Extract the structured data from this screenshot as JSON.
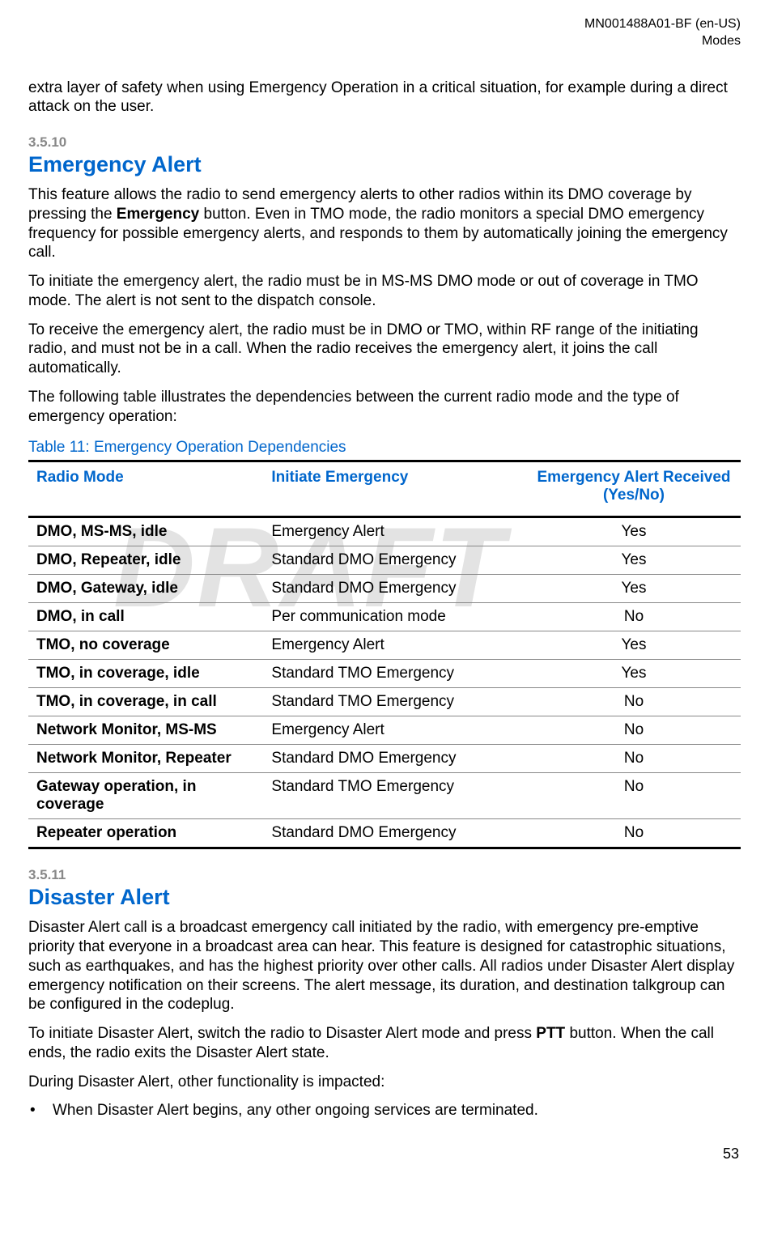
{
  "header": {
    "doc_id": "MN001488A01-BF (en-US)",
    "chapter": "Modes"
  },
  "watermark": "DRAFT",
  "intro": "extra layer of safety when using Emergency Operation in a critical situation, for example during a direct attack on the user.",
  "s1": {
    "num": "3.5.10",
    "title": "Emergency Alert",
    "p1a": "This feature allows the radio to send emergency alerts to other radios within its DMO coverage by pressing the ",
    "p1_bold": "Emergency",
    "p1b": " button. Even in TMO mode, the radio monitors a special DMO emergency frequency for possible emergency alerts, and responds to them by automatically joining the emergency call.",
    "p2": "To initiate the emergency alert, the radio must be in MS-MS DMO mode or out of coverage in TMO mode. The alert is not sent to the dispatch console.",
    "p3": "To receive the emergency alert, the radio must be in DMO or TMO, within RF range of the initiating radio, and must not be in a call. When the radio receives the emergency alert, it joins the call automatically.",
    "p4": "The following table illustrates the dependencies between the current radio mode and the type of emergency operation:"
  },
  "table": {
    "caption": "Table 11: Emergency Operation Dependencies",
    "h1": "Radio Mode",
    "h2": "Initiate Emergency",
    "h3": "Emergency Alert Received (Yes/No)",
    "rows": [
      {
        "c1": "DMO, MS-MS, idle",
        "c2": "Emergency Alert",
        "c3": "Yes"
      },
      {
        "c1": "DMO, Repeater, idle",
        "c2": "Standard DMO Emergency",
        "c3": "Yes"
      },
      {
        "c1": "DMO, Gateway, idle",
        "c2": "Standard DMO Emergency",
        "c3": "Yes"
      },
      {
        "c1": "DMO, in call",
        "c2": "Per communication mode",
        "c3": "No"
      },
      {
        "c1": "TMO, no coverage",
        "c2": "Emergency Alert",
        "c3": "Yes"
      },
      {
        "c1": "TMO, in coverage, idle",
        "c2": "Standard TMO Emergency",
        "c3": "Yes"
      },
      {
        "c1": "TMO, in coverage, in call",
        "c2": "Standard TMO Emergency",
        "c3": "No"
      },
      {
        "c1": "Network Monitor, MS-MS",
        "c2": "Emergency Alert",
        "c3": "No"
      },
      {
        "c1": "Network Monitor, Repeater",
        "c2": "Standard DMO Emergency",
        "c3": "No"
      },
      {
        "c1": "Gateway operation, in coverage",
        "c2": "Standard TMO Emergency",
        "c3": "No"
      },
      {
        "c1": "Repeater operation",
        "c2": "Standard DMO Emergency",
        "c3": "No"
      }
    ]
  },
  "s2": {
    "num": "3.5.11",
    "title": "Disaster Alert",
    "p1": "Disaster Alert call is a broadcast emergency call initiated by the radio, with emergency pre-emptive priority that everyone in a broadcast area can hear. This feature is designed for catastrophic situations, such as earthquakes, and has the highest priority over other calls. All radios under Disaster Alert display emergency notification on their screens. The alert message, its duration, and destination talkgroup can be configured in the codeplug.",
    "p2a": "To initiate Disaster Alert, switch the radio to Disaster Alert mode and press ",
    "p2_bold": "PTT",
    "p2b": " button. When the call ends, the radio exits the Disaster Alert state.",
    "p3": "During Disaster Alert, other functionality is impacted:",
    "bullet1": "When Disaster Alert begins, any other ongoing services are terminated."
  },
  "page_num": "53"
}
